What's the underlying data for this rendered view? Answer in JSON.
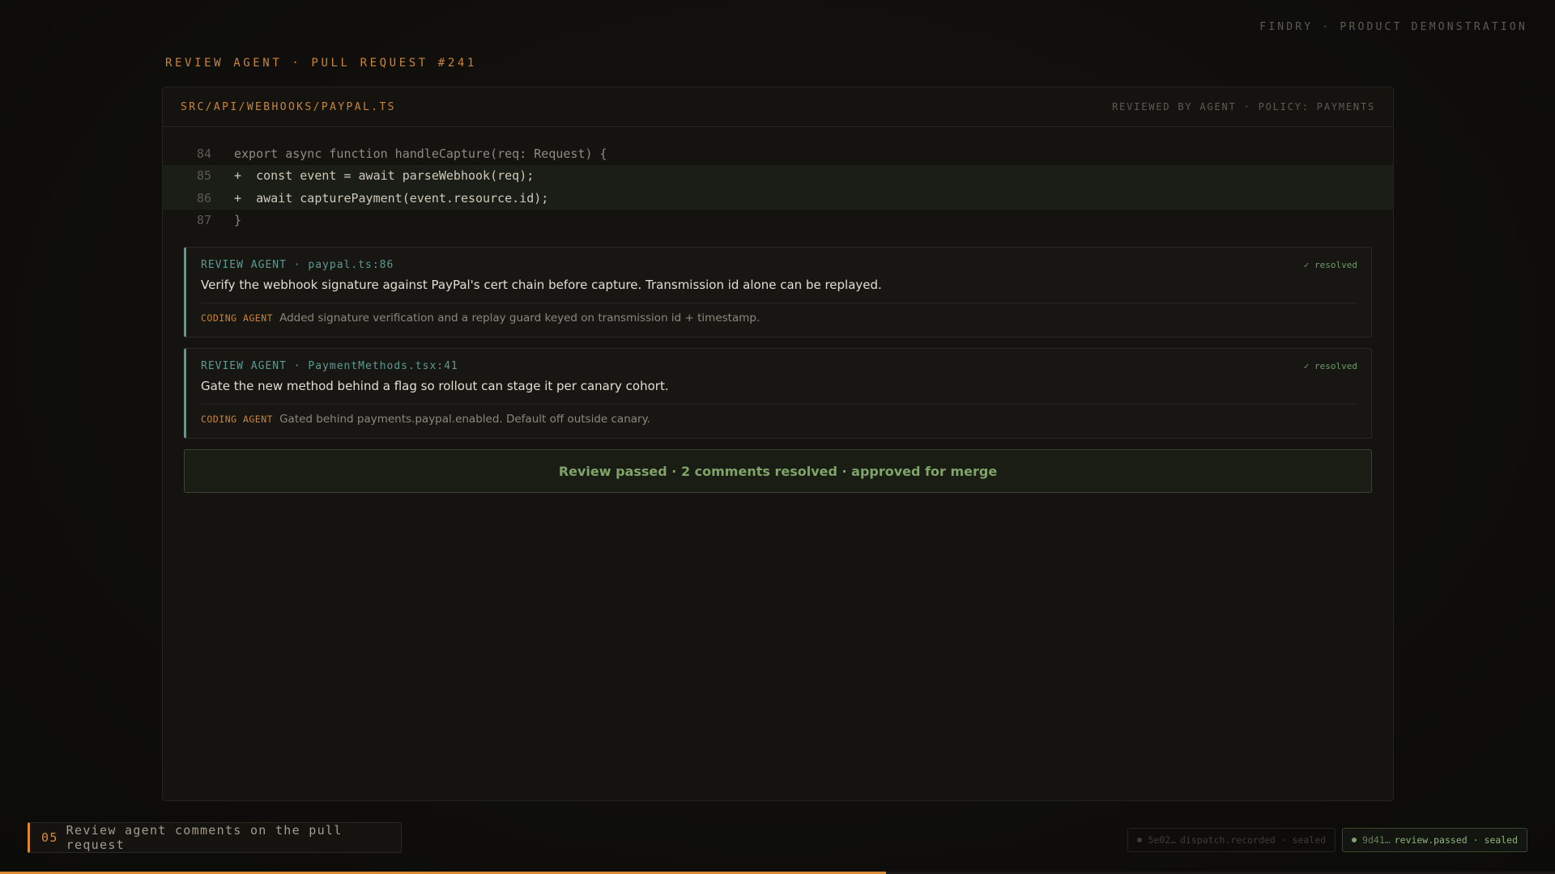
{
  "brand": "FINDRY · PRODUCT DEMONSTRATION",
  "breadcrumb": "REVIEW AGENT · PULL REQUEST #241",
  "panel": {
    "file_path": "SRC/API/WEBHOOKS/PAYPAL.TS",
    "review_meta": "REVIEWED BY AGENT · POLICY: PAYMENTS"
  },
  "code_lines": [
    {
      "num": "84",
      "text": "export async function handleCapture(req: Request) {",
      "added": false
    },
    {
      "num": "85",
      "text": "+  const event = await parseWebhook(req);",
      "added": true
    },
    {
      "num": "86",
      "text": "+  await capturePayment(event.resource.id);",
      "added": true
    },
    {
      "num": "87",
      "text": "}",
      "added": false
    }
  ],
  "comments": [
    {
      "header": "REVIEW AGENT · paypal.ts:86",
      "status": "✓ resolved",
      "body": "Verify the webhook signature against PayPal's cert chain before capture. Transmission id alone can be replayed.",
      "reply_tag": "CODING AGENT",
      "reply": "Added signature verification and a replay guard keyed on transmission id + timestamp."
    },
    {
      "header": "REVIEW AGENT · PaymentMethods.tsx:41",
      "status": "✓ resolved",
      "body": "Gate the new method behind a flag so rollout can stage it per canary cohort.",
      "reply_tag": "CODING AGENT",
      "reply": "Gated behind payments.paypal.enabled. Default off outside canary."
    }
  ],
  "review_passed": "Review passed · 2 comments resolved · approved for merge",
  "step": {
    "number": "05",
    "label": "Review agent comments on the pull request"
  },
  "chips": [
    {
      "hash": "5e02…",
      "label": "dispatch.recorded · sealed",
      "active": false
    },
    {
      "hash": "9d41…",
      "label": "review.passed · sealed",
      "active": true
    }
  ],
  "progress": 0.57,
  "colors": {
    "accent": "#d88a34",
    "review": "#5c9a90",
    "success": "#7fa368"
  }
}
